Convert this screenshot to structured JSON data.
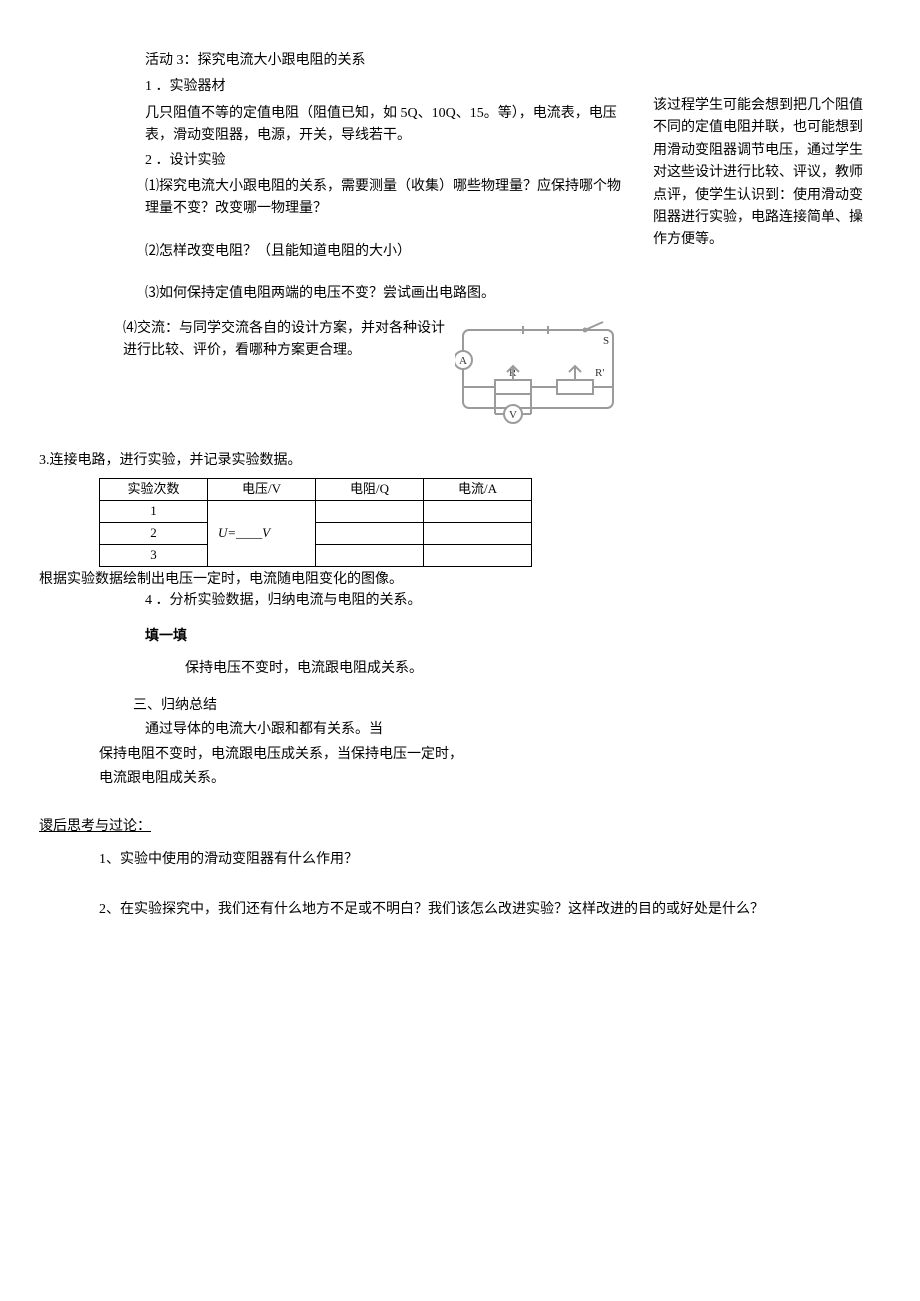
{
  "activity": {
    "title": "活动 3：探究电流大小跟电阻的关系",
    "sec1_title": "1 ．实验器材",
    "sec1_body": "几只阻值不等的定值电阻（阻值已知，如 5Q、10Q、15。等），电流表，电压表，滑动变阻器，电源，开关，导线若干。",
    "sec2_title": "2 ．设计实验",
    "sec2_q1": "⑴探究电流大小跟电阻的关系，需要测量（收集）哪些物理量？应保持哪个物理量不变？改变哪一物理量？",
    "sec2_q2": "⑵怎样改变电阻？（且能知道电阻的大小）",
    "sec2_q3": "⑶如何保持定值电阻两端的电压不变？尝试画出电路图。",
    "sec2_q4": "⑷交流：与同学交流各自的设计方案，并对各种设计进行比较、评价，看哪种方案更合理。"
  },
  "side_note": "该过程学生可能会想到把几个阻值不同的定值电阻并联，也可能想到用滑动变阻器调节电压，通过学生对这些设计进行比较、评议，教师点评，使学生认识到：使用滑动变阻器进行实验，电路连接简单、操作方便等。",
  "circuit": {
    "label_a": "A",
    "label_v": "V",
    "label_r": "R",
    "label_rp": "R'",
    "label_s": "S"
  },
  "section3": {
    "title": "3.连接电路，进行实验，并记录实验数据。",
    "headers": {
      "c1": "实验次数",
      "c2": "电压/V",
      "c3": "电阻/Q",
      "c4": "电流/A"
    },
    "rows": {
      "r1": "1",
      "r2": "2",
      "r3": "3"
    },
    "voltage_cell": "U=____V",
    "after_table": "根据实验数据绘制出电压一定时，电流随电阻变化的图像。"
  },
  "section4": {
    "title": "4 ．分析实验数据，归纳电流与电阻的关系。",
    "fill_label": "填一填",
    "fill_body": "保持电压不变时，电流跟电阻成关系。"
  },
  "section5": {
    "title": "三、归纳总结",
    "body": "通过导体的电流大小跟和都有关系。当",
    "body2": "保持电阻不变时，电流跟电压成关系，当保持电压一定时，",
    "body3": "电流跟电阻成关系。"
  },
  "discuss": {
    "title": "谡后思考与过论：",
    "q1": "1、实验中使用的滑动变阻器有什么作用？",
    "q2": "2、在实验探究中，我们还有什么地方不足或不明白？我们该怎么改进实验？这样改进的目的或好处是什么？"
  }
}
